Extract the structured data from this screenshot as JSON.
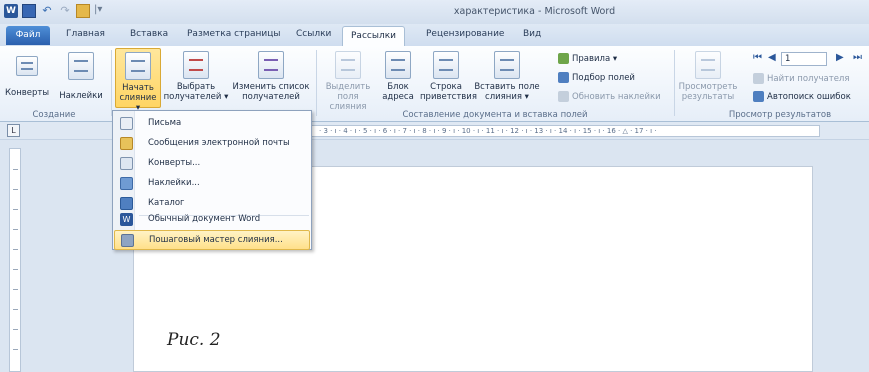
{
  "window": {
    "title": "характеристика - Microsoft Word"
  },
  "tabs": [
    {
      "label": "Файл"
    },
    {
      "label": "Главная"
    },
    {
      "label": "Вставка"
    },
    {
      "label": "Разметка страницы"
    },
    {
      "label": "Ссылки"
    },
    {
      "label": "Рассылки"
    },
    {
      "label": "Рецензирование"
    },
    {
      "label": "Вид"
    }
  ],
  "ribbon": {
    "create": {
      "envelopes": "Конверты",
      "labels": "Наклейки",
      "group": "Создание"
    },
    "start_merge": {
      "start_line1": "Начать",
      "start_line2": "слияние ▾",
      "select_line1": "Выбрать",
      "select_line2": "получателей ▾",
      "edit_line1": "Изменить список",
      "edit_line2": "получателей"
    },
    "compose": {
      "highlight_line1": "Выделить",
      "highlight_line2": "поля слияния",
      "address_line1": "Блок",
      "address_line2": "адреса",
      "greeting_line1": "Строка",
      "greeting_line2": "приветствия",
      "insert_line1": "Вставить поле",
      "insert_line2": "слияния ▾",
      "rules": "Правила ▾",
      "match_fields": "Подбор полей",
      "update_labels": "Обновить наклейки",
      "group": "Составление документа и вставка полей"
    },
    "preview": {
      "preview_line1": "Просмотреть",
      "preview_line2": "результаты",
      "record_value": "1",
      "find_recipient": "Найти получателя",
      "auto_check": "Автопоиск ошибок",
      "group": "Просмотр результатов"
    }
  },
  "ruler": {
    "corner": "L",
    "marks": "· 3 · ı · 4 · ı · 5 · ı · 6 · ı · 7 · ı · 8 · ı · 9 · ı · 10 · ı · 11 · ı · 12 · ı · 13 · ı · 14 · ı · 15 · ı · 16 · △ · 17 · ı ·"
  },
  "menu": {
    "items": [
      {
        "label": "Письма"
      },
      {
        "label": "Сообщения электронной почты"
      },
      {
        "label": "Конверты..."
      },
      {
        "label": "Наклейки..."
      },
      {
        "label": "Каталог"
      },
      {
        "label": "Обычный документ Word"
      },
      {
        "label": "Пошаговый мастер слияния..."
      }
    ]
  },
  "document": {
    "caption": "Рис. 2"
  },
  "colors": {
    "accent": "#2b579a",
    "highlight": "#ffe08a",
    "ribbon_bg": "#e6eef8"
  }
}
